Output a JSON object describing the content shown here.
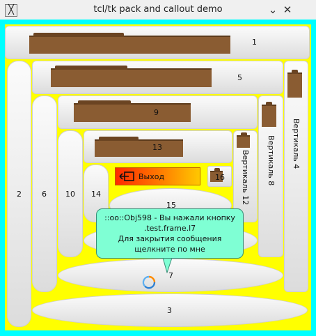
{
  "window": {
    "title": "tcl/tk pack and callout demo",
    "minimize_glyph": "⌄",
    "close_glyph": "✕",
    "app_icon_glyph": "╳"
  },
  "buttons": {
    "b1": "1",
    "b2": "2",
    "b3": "3",
    "b5": "5",
    "b6": "6",
    "b7": "7",
    "b9": "9",
    "b10": "10",
    "b13": "13",
    "b14": "14",
    "b15": "15",
    "b16": "16",
    "v4": "Вертикаль 4",
    "v8": "Вертикаль 8",
    "v12": "Вертикаль 12",
    "exit": "Выход"
  },
  "callout": {
    "line1": "::oo::Obj598 - Вы нажали кнопку",
    "line2": ".test.frame.l7",
    "line3": "Для закрытия сообщения",
    "line4": "щелкните по мне"
  },
  "colors": {
    "border": "#00ffff",
    "frame": "#ffff00",
    "callout": "#7fffd4",
    "folder": "#8a5c32"
  },
  "icons": {
    "folder": "folder-icon",
    "exit": "exit-icon",
    "spinner": "refresh-spinner-icon"
  }
}
